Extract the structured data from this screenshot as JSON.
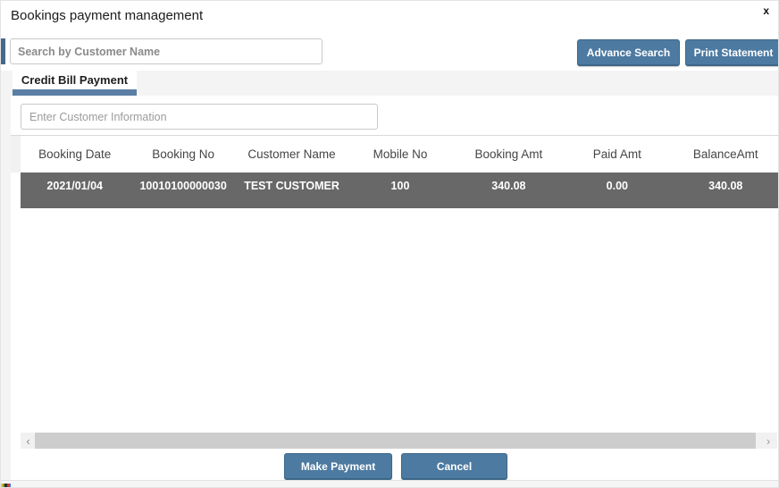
{
  "dialog": {
    "title": "Bookings payment management",
    "close_label": "x"
  },
  "toolbar": {
    "search_placeholder": "Search by Customer Name",
    "search_value": "",
    "advance_search_label": "Advance Search",
    "print_statement_label": "Print Statement"
  },
  "tabs": {
    "active_label": "Credit Bill Payment"
  },
  "filter": {
    "customer_info_placeholder": "Enter Customer Information",
    "customer_info_value": ""
  },
  "table": {
    "columns": [
      "Booking Date",
      "Booking No",
      "Customer Name",
      "Mobile No",
      "Booking Amt",
      "Paid Amt",
      "BalanceAmt"
    ],
    "rows": [
      {
        "booking_date": "2021/01/04",
        "booking_no": "10010100000030",
        "customer_name": "TEST CUSTOMER",
        "mobile_no": "100",
        "booking_amt": "340.08",
        "paid_amt": "0.00",
        "balance_amt": "340.08",
        "selected": true
      }
    ]
  },
  "scrollbar": {
    "left_arrow": "‹",
    "right_arrow": "›"
  },
  "footer": {
    "make_payment_label": "Make Payment",
    "cancel_label": "Cancel"
  },
  "colors": {
    "accent_button": "#4d7aa1",
    "tab_underline": "#5b7fa4",
    "selected_row_bg": "#686868",
    "tab_strip_bg": "#f4f4f4"
  }
}
